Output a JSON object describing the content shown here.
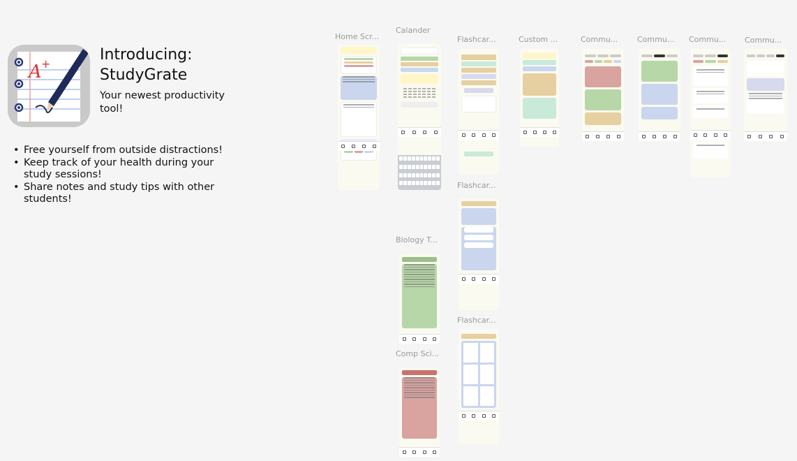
{
  "intro": {
    "title_line1": "Introducing:",
    "title_line2": "StudyGrate",
    "subtitle": "Your newest productivity tool!",
    "bullets": [
      "Free yourself from outside distractions!",
      "Keep track of your health during your study sessions!",
      "Share notes and study tips with other students!"
    ]
  },
  "frames": {
    "home": "Home Scr...",
    "calendar": "Calander",
    "flashcards1": "Flashcar...",
    "custom": "Custom ...",
    "community1": "Commu...",
    "community2": "Commu...",
    "community3": "Commu...",
    "community4": "Commu...",
    "flashcards2": "Flashcar...",
    "biology": "Biology T...",
    "flashcards3": "Flashcar...",
    "compsci": "Comp Sci..."
  },
  "colors": {
    "background": "#f5f5f5",
    "frame_bg": "#fafaf0",
    "green": "#b7d7a8",
    "red": "#d9a3a0",
    "tan": "#e6cfa0",
    "blue": "#c9d6ee",
    "lavender": "#d7d9ee",
    "navy": "#1e2a5a"
  },
  "icons": {
    "app": "notebook-pencil-grade-icon"
  }
}
